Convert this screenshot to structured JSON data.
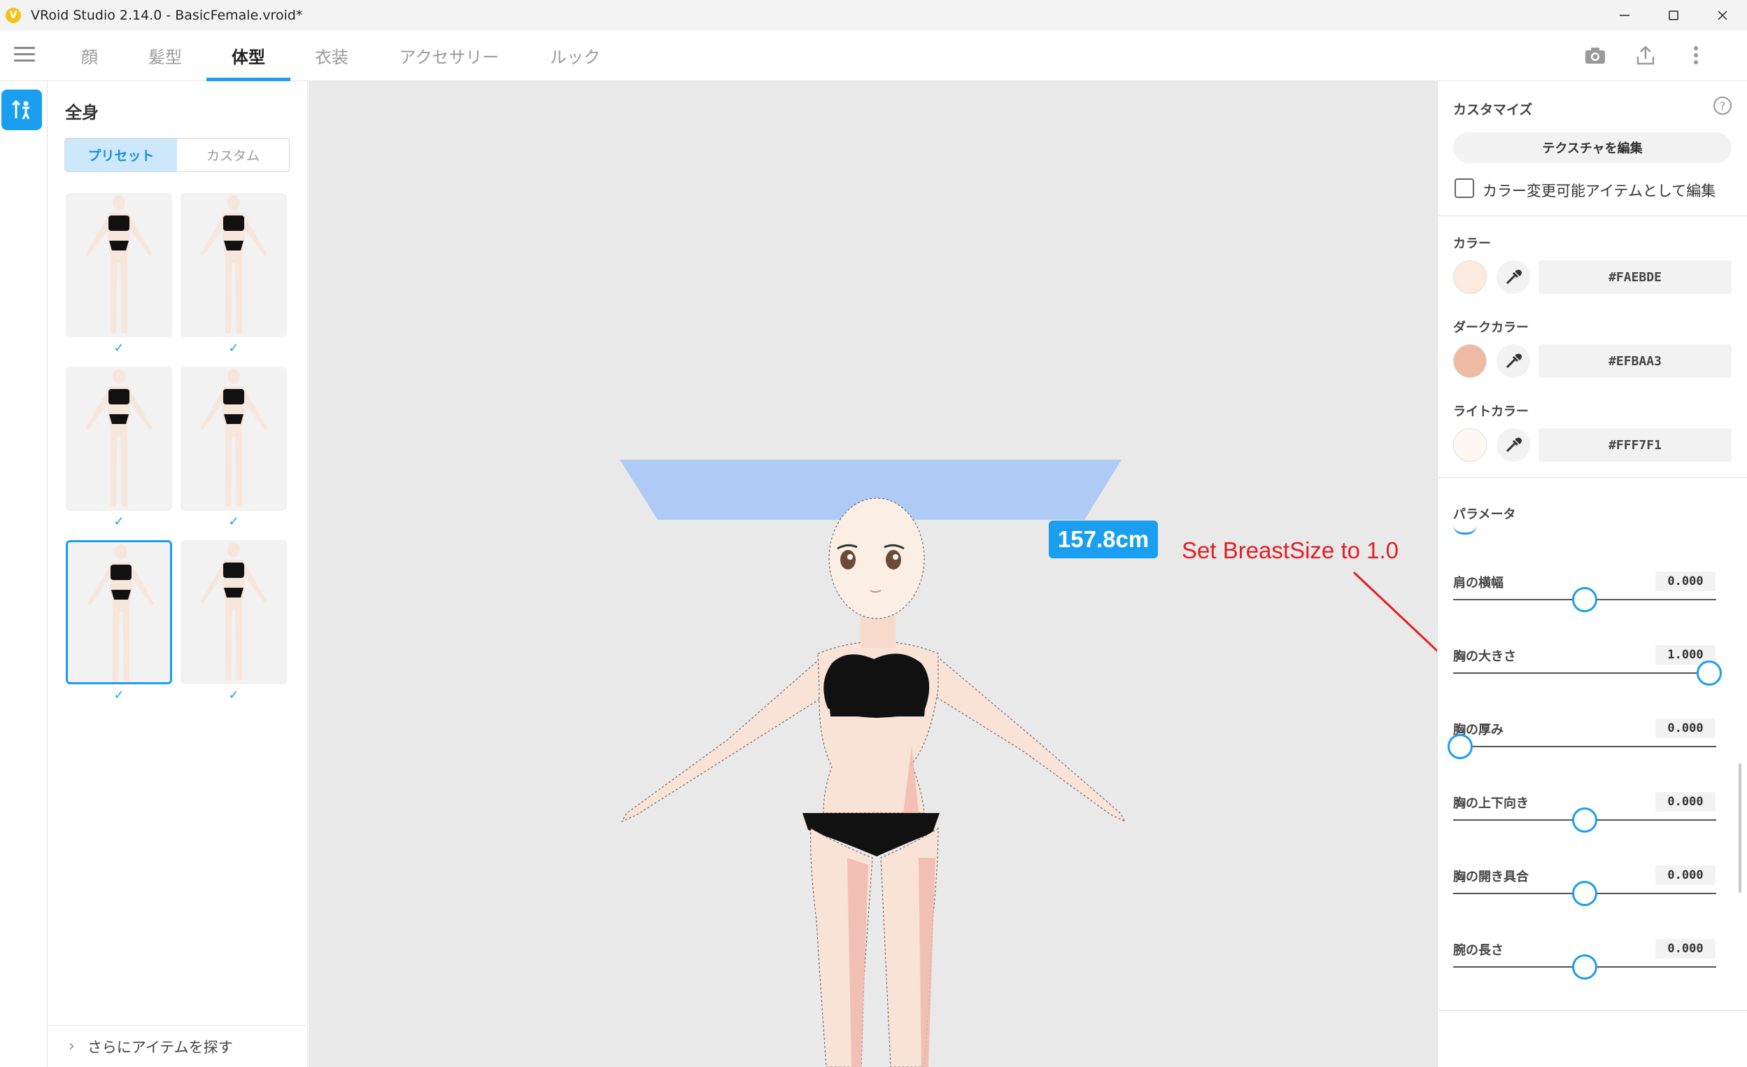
{
  "window": {
    "title": "VRoid Studio 2.14.0 - BasicFemale.vroid*",
    "logo_glyph": "V",
    "controls": [
      "minimize-icon",
      "maximize-icon",
      "close-icon"
    ]
  },
  "tabs": [
    {
      "label": "顔",
      "active": false
    },
    {
      "label": "髪型",
      "active": false
    },
    {
      "label": "体型",
      "active": true
    },
    {
      "label": "衣装",
      "active": false
    },
    {
      "label": "アクセサリー",
      "active": false
    },
    {
      "label": "ルック",
      "active": false
    }
  ],
  "toolbar_icons": [
    "camera-icon",
    "export-icon",
    "more-vertical-icon"
  ],
  "left_panel": {
    "title": "全身",
    "segments": {
      "preset": "プリセット",
      "custom": "カスタム",
      "active": "preset"
    },
    "presets_count": 6,
    "selected_preset": 5,
    "footer": "さらにアイテムを探す"
  },
  "viewport": {
    "height_label": "157.8cm",
    "annotation": "Set BreastSize to 1.0",
    "colors": {
      "annotation": "#e01f26",
      "accent": "#1a9ef0",
      "guide": "#aecbf5"
    }
  },
  "right_panel": {
    "customize_title": "カスタマイズ",
    "edit_texture_button": "テクスチャを編集",
    "editable_color_checkbox": "カラー変更可能アイテムとして編集",
    "colors": [
      {
        "label": "カラー",
        "hex": "#FAEBDE",
        "swatch": "#FAEBDE"
      },
      {
        "label": "ダークカラー",
        "hex": "#EFBAA3",
        "swatch": "#EFBAA3"
      },
      {
        "label": "ライトカラー",
        "hex": "#FFF7F1",
        "swatch": "#FFF7F1"
      }
    ],
    "parameters_title": "パラメータ",
    "parameters": [
      {
        "label": "肩の横幅",
        "value": "0.000",
        "fraction": 0.5
      },
      {
        "label": "胸の大きさ",
        "value": "1.000",
        "fraction": 1.0
      },
      {
        "label": "胸の厚み",
        "value": "0.000",
        "fraction": 0.0
      },
      {
        "label": "胸の上下向き",
        "value": "0.000",
        "fraction": 0.5
      },
      {
        "label": "胸の開き具合",
        "value": "0.000",
        "fraction": 0.5
      },
      {
        "label": "腕の長さ",
        "value": "0.000",
        "fraction": 0.5
      }
    ]
  }
}
